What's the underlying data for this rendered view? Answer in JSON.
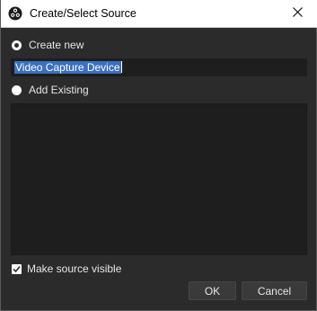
{
  "window": {
    "title": "Create/Select Source",
    "icon": "obs-logo-icon",
    "close_icon": "close-icon"
  },
  "create_new": {
    "label": "Create new",
    "checked": true,
    "name_value": "Video Capture Device"
  },
  "add_existing": {
    "label": "Add Existing",
    "checked": false,
    "items": []
  },
  "make_visible": {
    "label": "Make source visible",
    "checked": true
  },
  "buttons": {
    "ok_label": "OK",
    "cancel_label": "Cancel"
  },
  "colors": {
    "background": "#2b2b2b",
    "field": "#1e1e1e",
    "selection": "#3b6fc1",
    "button": "#3a3a3a"
  }
}
